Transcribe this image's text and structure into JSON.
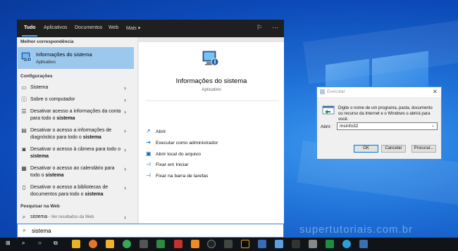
{
  "tabs": [
    {
      "label": "Tudo"
    },
    {
      "label": "Aplicativos"
    },
    {
      "label": "Documentos"
    },
    {
      "label": "Web"
    },
    {
      "label": "Mais ▾"
    }
  ],
  "best_match": {
    "header": "Melhor correspondência",
    "title": "Informações do sistema",
    "subtitle": "Aplicativo"
  },
  "settings": {
    "header": "Configurações",
    "items": [
      {
        "text": "Sistema",
        "icon": "monitor-icon"
      },
      {
        "text": "Sobre o computador",
        "icon": "info-icon"
      },
      {
        "text": "Desativar acesso a informações da conta para todo o sistema",
        "icon": "account-info-icon"
      },
      {
        "text": "Desativar o acesso a informações de diagnóstico para todo o sistema",
        "icon": "diagnostic-icon"
      },
      {
        "text": "Desativar o acesso à câmera para todo o sistema",
        "icon": "camera-icon"
      },
      {
        "text": "Desativar o acesso ao calendário para todo o sistema",
        "icon": "calendar-icon"
      },
      {
        "text": "Desativar o acesso a bibliotecas de documentos para todo o sistema",
        "icon": "document-icon"
      }
    ]
  },
  "web": {
    "header": "Pesquisar na Web",
    "query": "sistema",
    "suffix": " - Ver resultados da Web"
  },
  "detail": {
    "title": "Informações do sistema",
    "subtitle": "Aplicativo",
    "actions": [
      {
        "label": "Abrir",
        "icon": "open-icon"
      },
      {
        "label": "Executar como administrador",
        "icon": "admin-icon"
      },
      {
        "label": "Abrir local do arquivo",
        "icon": "folder-icon"
      },
      {
        "label": "Fixar em Iniciar",
        "icon": "pin-icon"
      },
      {
        "label": "Fixar na barra de tarefas",
        "icon": "pin-taskbar-icon"
      }
    ]
  },
  "search_input": {
    "value": "sistema"
  },
  "run_dialog": {
    "title": "Executar",
    "description": "Digite o nome de um programa, pasta, documento ou recurso da Internet e o Windows o abrirá para você.",
    "label": "Abrir:",
    "value": "msinfo32",
    "ok": "OK",
    "cancel": "Cancelar",
    "browse": "Procurar..."
  },
  "watermark": "supertutoriais.com.br",
  "colors": {
    "accent": "#0078d7",
    "selected": "#9cc8ed",
    "topbar": "#1f1f1f"
  }
}
